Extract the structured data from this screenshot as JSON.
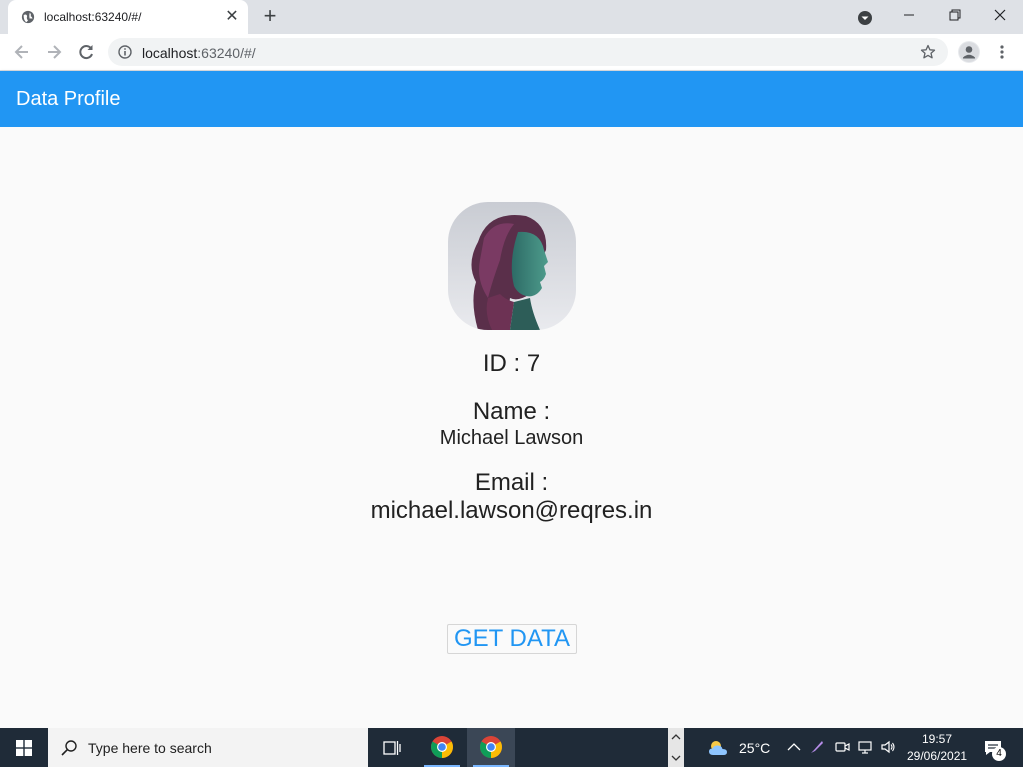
{
  "browser": {
    "tab_title": "localhost:63240/#/",
    "new_tab_glyph": "+",
    "close_glyph": "✕",
    "url_host": "localhost",
    "url_rest": ":63240/#/"
  },
  "app": {
    "title": "Data Profile",
    "primary_color": "#2196f3",
    "profile": {
      "id_text": "ID : 7",
      "name_label": "Name :",
      "name_value": "Michael Lawson",
      "email_label": "Email :",
      "email_value": "michael.lawson@reqres.in"
    },
    "button_label": "GET DATA"
  },
  "taskbar": {
    "search_placeholder": "Type here to search",
    "weather": "25°C",
    "time": "19:57",
    "date": "29/06/2021",
    "notification_count": "4"
  }
}
